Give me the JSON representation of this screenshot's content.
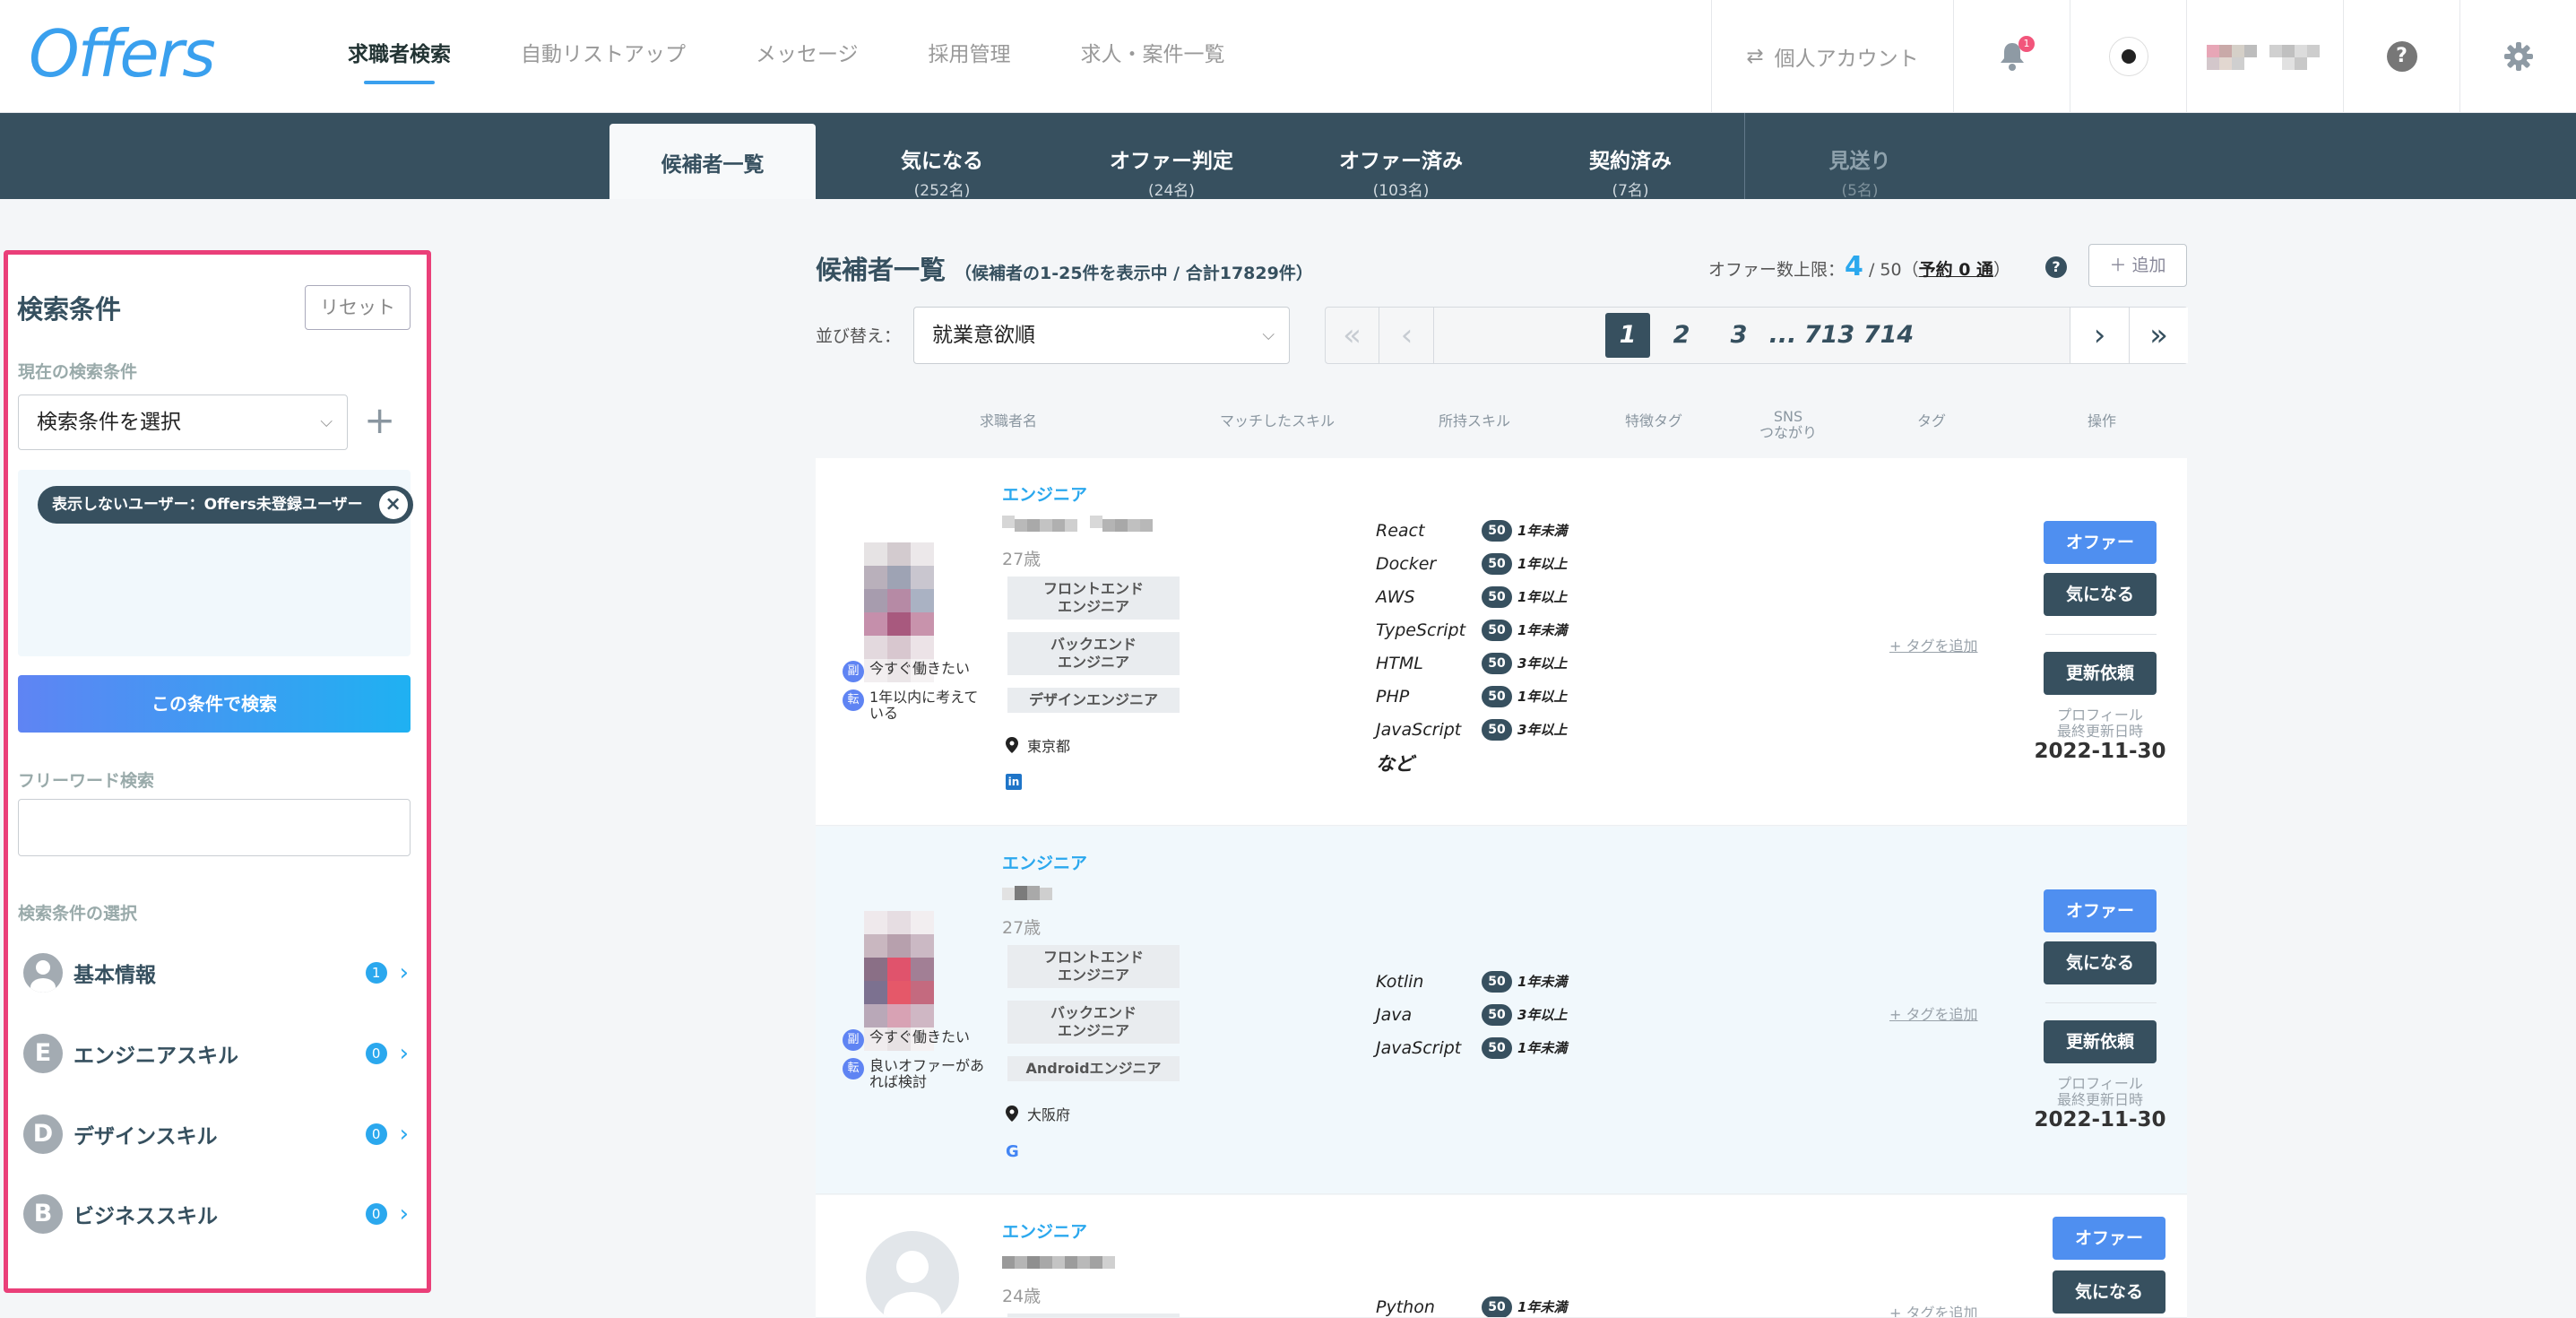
{
  "header": {
    "logo": "Offers",
    "nav": [
      "求職者検索",
      "自動リストアップ",
      "メッセージ",
      "採用管理",
      "求人・案件一覧"
    ],
    "account_label": "個人アカウント",
    "bell_count": "1"
  },
  "tabs": [
    {
      "label": "候補者一覧",
      "count": ""
    },
    {
      "label": "気になる",
      "count": "(252名)"
    },
    {
      "label": "オファー判定",
      "count": "(24名)"
    },
    {
      "label": "オファー済み",
      "count": "(103名)"
    },
    {
      "label": "契約済み",
      "count": "(7名)"
    },
    {
      "label": "見送り",
      "count": "(5名)"
    }
  ],
  "sidebar": {
    "title": "検索条件",
    "reset": "リセット",
    "current_label": "現在の検索条件",
    "select_placeholder": "検索条件を選択",
    "plus": "+",
    "chip": "表示しないユーザー：Offers未登録ユーザー",
    "search_button": "この条件で検索",
    "freeword_label": "フリーワード検索",
    "select_label": "検索条件の選択",
    "categories": [
      {
        "icon": "",
        "label": "基本情報",
        "count": "1"
      },
      {
        "icon": "E",
        "label": "エンジニアスキル",
        "count": "0"
      },
      {
        "icon": "D",
        "label": "デザインスキル",
        "count": "0"
      },
      {
        "icon": "B",
        "label": "ビジネススキル",
        "count": "0"
      }
    ]
  },
  "main": {
    "title": "候補者一覧",
    "subtitle": "（候補者の1-25件を表示中 / 合計17829件）",
    "offer_limit_label": "オファー数上限：",
    "offer_count": "4",
    "offer_max": "/ 50",
    "reserve": "予約 0 通",
    "add_button": "追加",
    "sort_label": "並び替え：",
    "sort_value": "就業意欲順",
    "pages": [
      "1",
      "2",
      "3",
      "...",
      "713",
      "714"
    ],
    "columns": [
      "求職者名",
      "マッチしたスキル",
      "所持スキル",
      "特徴タグ",
      "SNS\nつながり",
      "タグ",
      "操作"
    ],
    "tag_add": "+ タグを追加",
    "offer_btn": "オファー",
    "like_btn": "気になる",
    "update_btn": "更新依頼",
    "profile_updated": "プロフィール\n最終更新日時",
    "candidates": [
      {
        "role": "エンジニア",
        "age": "27歳",
        "jobs": [
          "フロントエンド\nエンジニア",
          "バックエンド\nエンジニア",
          "デザインエンジニア"
        ],
        "intents": [
          {
            "ico": "副",
            "text": "今すぐ働きたい"
          },
          {
            "ico": "転",
            "text": "1年以内に考えて\nいる"
          }
        ],
        "location": "東京都",
        "sns": "in",
        "skills": [
          {
            "name": "React",
            "lv": "50",
            "yr": "1年未満"
          },
          {
            "name": "Docker",
            "lv": "50",
            "yr": "1年以上"
          },
          {
            "name": "AWS",
            "lv": "50",
            "yr": "1年以上"
          },
          {
            "name": "TypeScript",
            "lv": "50",
            "yr": "1年未満"
          },
          {
            "name": "HTML",
            "lv": "50",
            "yr": "3年以上"
          },
          {
            "name": "PHP",
            "lv": "50",
            "yr": "1年以上"
          },
          {
            "name": "JavaScript",
            "lv": "50",
            "yr": "3年以上"
          }
        ],
        "etc": "など",
        "date": "2022-11-30"
      },
      {
        "role": "エンジニア",
        "age": "27歳",
        "jobs": [
          "フロントエンド\nエンジニア",
          "バックエンド\nエンジニア",
          "Androidエンジニア"
        ],
        "intents": [
          {
            "ico": "副",
            "text": "今すぐ働きたい"
          },
          {
            "ico": "転",
            "text": "良いオファーがあ\nれば検討"
          }
        ],
        "location": "大阪府",
        "sns": "G",
        "skills": [
          {
            "name": "Kotlin",
            "lv": "50",
            "yr": "1年未満"
          },
          {
            "name": "Java",
            "lv": "50",
            "yr": "3年以上"
          },
          {
            "name": "JavaScript",
            "lv": "50",
            "yr": "1年未満"
          }
        ],
        "etc": "",
        "date": "2022-11-30"
      },
      {
        "role": "エンジニア",
        "age": "24歳",
        "skills": [
          {
            "name": "Python",
            "lv": "50",
            "yr": "1年未満"
          }
        ]
      }
    ]
  },
  "colors": {
    "accent": "#2ba8ee",
    "dark": "#37505f",
    "highlight": "#ea3f79"
  }
}
